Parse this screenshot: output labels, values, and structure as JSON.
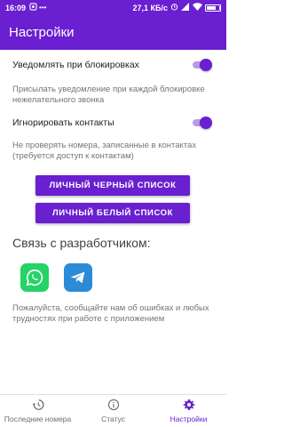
{
  "status_bar": {
    "time": "16:09",
    "net_speed": "27,1 КБ/с",
    "battery_level": 0.6
  },
  "app_bar": {
    "title": "Настройки"
  },
  "settings": {
    "notify_block": {
      "label": "Уведомлять при блокировках",
      "enabled": true,
      "description": "Присылать уведомление при каждой блокировке нежелательного звонка"
    },
    "ignore_contacts": {
      "label": "Игнорировать контакты",
      "enabled": true,
      "description": "Не проверять номера, записанные в контактах (требуется доступ к контактам)"
    }
  },
  "buttons": {
    "blacklist": "ЛИЧНЫЙ ЧЕРНЫЙ СПИСОК",
    "whitelist": "ЛИЧНЫЙ БЕЛЫЙ СПИСОК"
  },
  "developer": {
    "title": "Связь с разработчиком:",
    "help": "Пожалуйста, сообщайте нам об ошибках и любых трудностях при работе с приложением",
    "contacts": [
      {
        "icon": "whatsapp-icon",
        "color": "#25d366"
      },
      {
        "icon": "telegram-icon",
        "color": "#2b8bd6"
      }
    ]
  },
  "bottom_nav": {
    "items": [
      {
        "label": "Последние номера",
        "icon": "history-icon",
        "active": false
      },
      {
        "label": "Статус",
        "icon": "info-icon",
        "active": false
      },
      {
        "label": "Настройки",
        "icon": "gear-icon",
        "active": true
      }
    ]
  },
  "colors": {
    "primary": "#6a1fd0",
    "switch_track": "#b89be8",
    "secondary_text": "#757575"
  }
}
